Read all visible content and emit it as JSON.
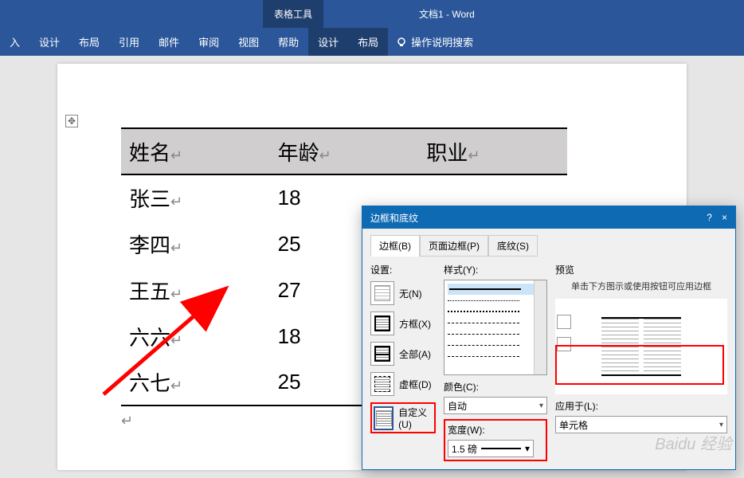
{
  "ribbon": {
    "tool_tab": "表格工具",
    "doc_title": "文档1 - Word",
    "tabs": [
      "入",
      "设计",
      "布局",
      "引用",
      "邮件",
      "审阅",
      "视图",
      "帮助",
      "设计",
      "布局"
    ],
    "help_search": "操作说明搜索"
  },
  "table": {
    "headers": [
      "姓名",
      "年龄",
      "职业"
    ],
    "rows": [
      [
        "张三",
        "18",
        ""
      ],
      [
        "李四",
        "25",
        ""
      ],
      [
        "王五",
        "27",
        ""
      ],
      [
        "六六",
        "18",
        ""
      ],
      [
        "六七",
        "25",
        ""
      ]
    ]
  },
  "dialog": {
    "title": "边框和底纹",
    "help": "?",
    "close": "×",
    "tabs": {
      "border": "边框(B)",
      "page_border": "页面边框(P)",
      "shading": "底纹(S)"
    },
    "settings": {
      "label": "设置:",
      "none": "无(N)",
      "box": "方框(X)",
      "all": "全部(A)",
      "dash": "虚框(D)",
      "custom": "自定义(U)"
    },
    "style": {
      "label": "样式(Y):"
    },
    "color": {
      "label": "颜色(C):",
      "value": "自动"
    },
    "width": {
      "label": "宽度(W):",
      "value": "1.5 磅"
    },
    "preview": {
      "label": "预览",
      "note": "单击下方图示或使用按钮可应用边框"
    },
    "apply": {
      "label": "应用于(L):",
      "value": "单元格"
    }
  },
  "watermark": "Baidu 经验"
}
